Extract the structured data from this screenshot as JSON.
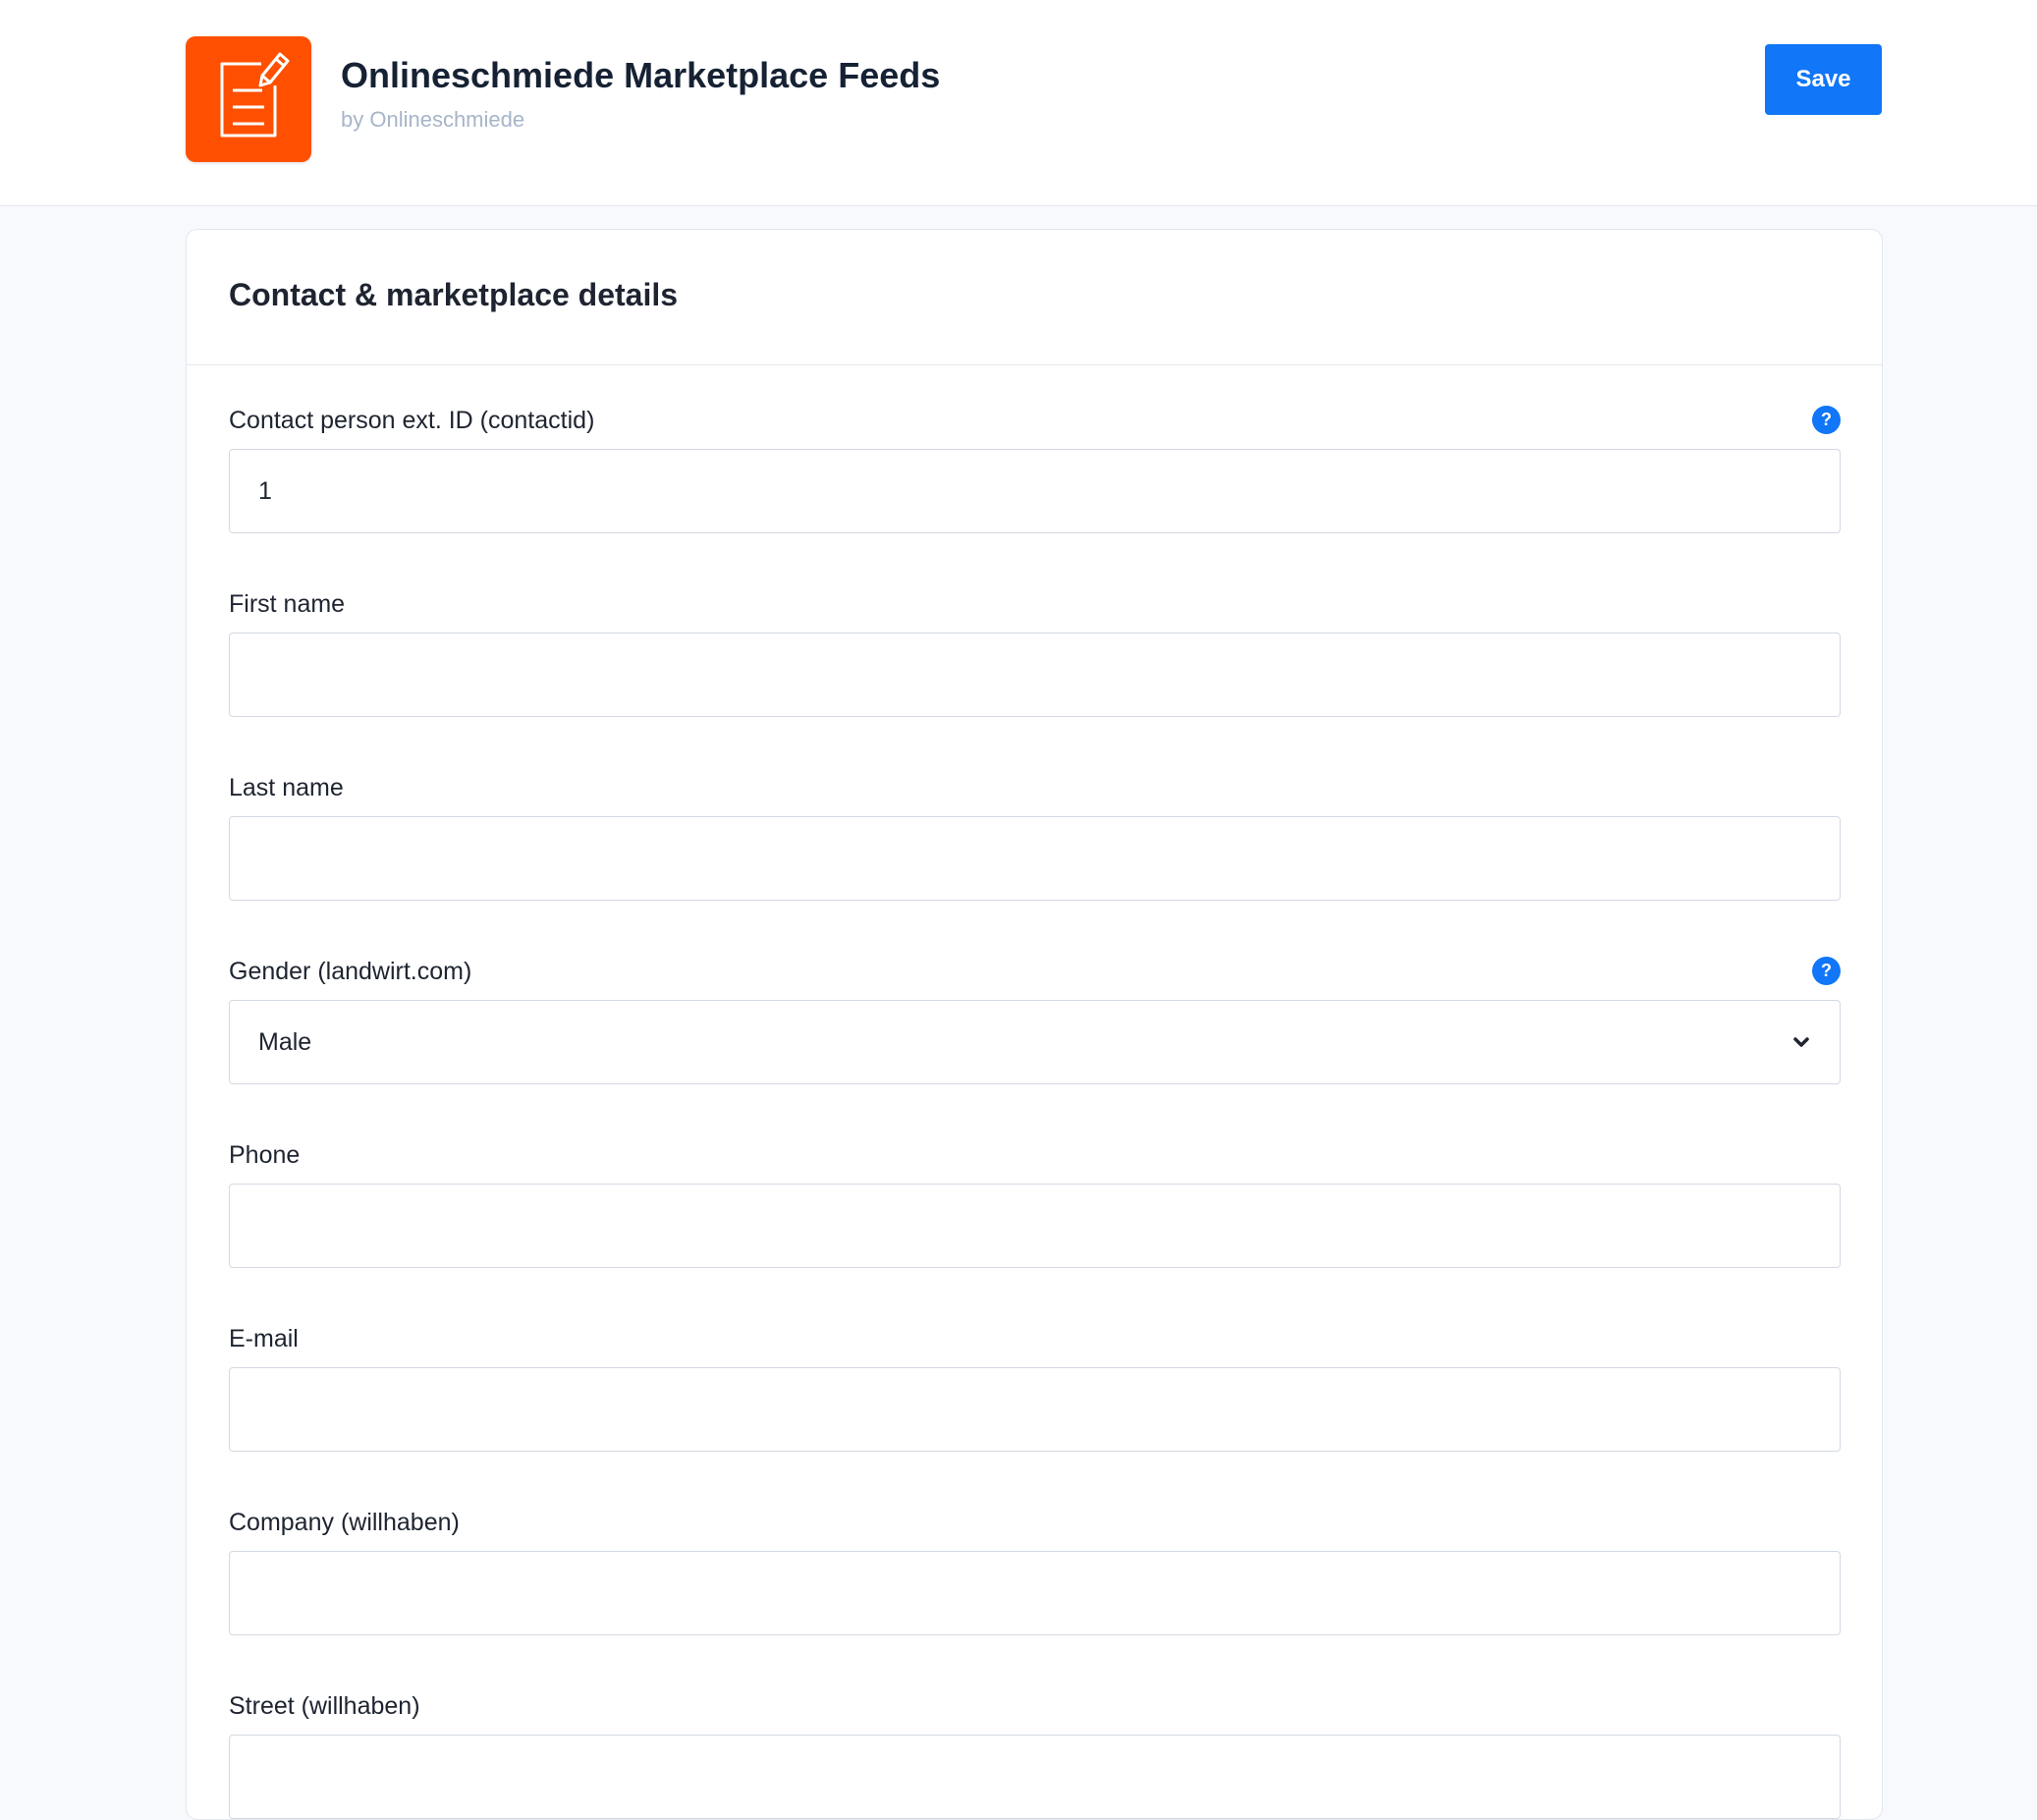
{
  "header": {
    "app_icon": "notepad-with-pencil-icon",
    "app_icon_color": "#fe5000",
    "title": "Onlineschmiede Marketplace Feeds",
    "subtitle": "by Onlineschmiede",
    "save_label": "Save"
  },
  "colors": {
    "accent": "#1176f7",
    "background": "#f8f9fc"
  },
  "form": {
    "title": "Contact & marketplace details",
    "fields": [
      {
        "label": "Contact person ext. ID (contactid)",
        "value": "1",
        "has_help": true,
        "type": "text"
      },
      {
        "label": "First name",
        "value": "",
        "type": "text"
      },
      {
        "label": "Last name",
        "value": "",
        "type": "text"
      },
      {
        "label": "Gender (landwirt.com)",
        "value": "Male",
        "has_help": true,
        "type": "select"
      },
      {
        "label": "Phone",
        "value": "",
        "type": "text"
      },
      {
        "label": "E-mail",
        "value": "",
        "type": "text"
      },
      {
        "label": "Company (willhaben)",
        "value": "",
        "type": "text"
      },
      {
        "label": "Street (willhaben)",
        "value": "",
        "type": "text"
      }
    ],
    "help_glyph": "?"
  }
}
